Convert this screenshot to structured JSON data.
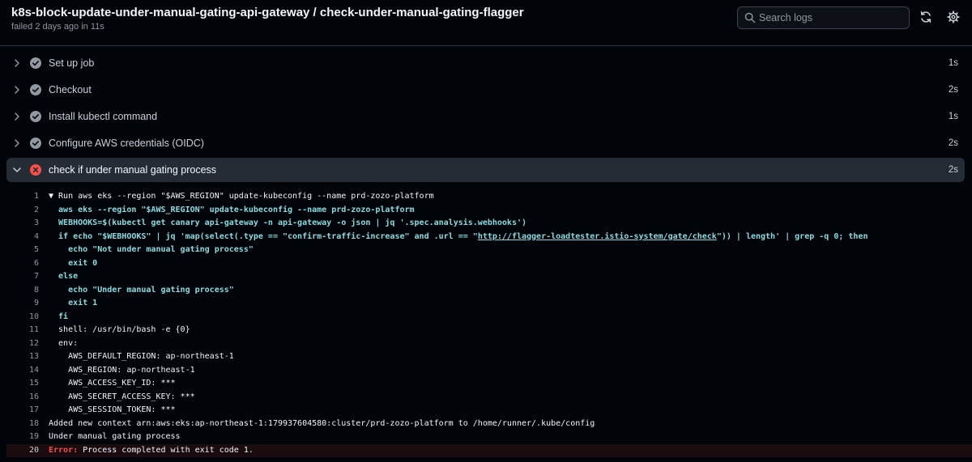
{
  "header": {
    "title": "k8s-block-update-under-manual-gating-api-gateway / check-under-manual-gating-flagger",
    "subtitle": "failed 2 days ago in 11s",
    "search_placeholder": "Search logs"
  },
  "steps": [
    {
      "name": "Set up job",
      "duration": "1s",
      "status": "success"
    },
    {
      "name": "Checkout",
      "duration": "2s",
      "status": "success"
    },
    {
      "name": "Install kubectl command",
      "duration": "1s",
      "status": "success"
    },
    {
      "name": "Configure AWS credentials (OIDC)",
      "duration": "2s",
      "status": "success"
    },
    {
      "name": "check if under manual gating process",
      "duration": "2s",
      "status": "failure"
    }
  ],
  "log": {
    "lines": [
      {
        "num": "1",
        "text": "▼ Run aws eks --region \"$AWS_REGION\" update-kubeconfig --name prd-zozo-platform"
      },
      {
        "num": "2",
        "text": "  aws eks --region \"$AWS_REGION\" update-kubeconfig --name prd-zozo-platform"
      },
      {
        "num": "3",
        "text": "  WEBHOOKS=$(kubectl get canary api-gateway -n api-gateway -o json | jq '.spec.analysis.webhooks')"
      },
      {
        "num": "4",
        "text_a": "  if echo \"$WEBHOOKS\" | jq 'map(select(.type == \"confirm-traffic-increase\" and .url == \"",
        "link": "http://flagger-loadtester.istio-system/gate/check",
        "text_b": "\")) | length' | grep -q 0; then"
      },
      {
        "num": "5",
        "text": "    echo \"Not under manual gating process\""
      },
      {
        "num": "6",
        "text": "    exit 0"
      },
      {
        "num": "7",
        "text": "  else"
      },
      {
        "num": "8",
        "text": "    echo \"Under manual gating process\""
      },
      {
        "num": "9",
        "text": "    exit 1"
      },
      {
        "num": "10",
        "text": "  fi"
      },
      {
        "num": "11",
        "text": "  shell: /usr/bin/bash -e {0}"
      },
      {
        "num": "12",
        "text": "  env:"
      },
      {
        "num": "13",
        "text": "    AWS_DEFAULT_REGION: ap-northeast-1"
      },
      {
        "num": "14",
        "text": "    AWS_REGION: ap-northeast-1"
      },
      {
        "num": "15",
        "text": "    AWS_ACCESS_KEY_ID: ***"
      },
      {
        "num": "16",
        "text": "    AWS_SECRET_ACCESS_KEY: ***"
      },
      {
        "num": "17",
        "text": "    AWS_SESSION_TOKEN: ***"
      },
      {
        "num": "18",
        "text": "Added new context arn:aws:eks:ap-northeast-1:179937604580:cluster/prd-zozo-platform to /home/runner/.kube/config"
      },
      {
        "num": "19",
        "text": "Under manual gating process"
      },
      {
        "num": "20",
        "error_label": "Error:",
        "text": " Process completed with exit code 1."
      }
    ]
  },
  "colors": {
    "background": "#010409",
    "success": "#9198a1",
    "failure": "#f85149",
    "command": "#8ddbe0",
    "active_step": "#262c36"
  }
}
